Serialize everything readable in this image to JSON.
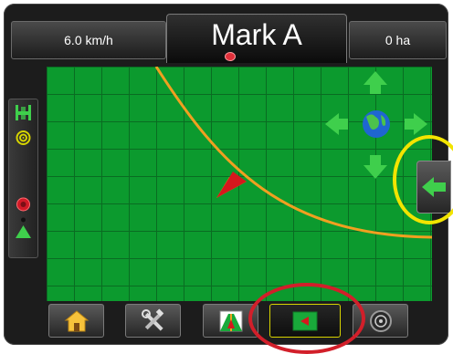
{
  "header": {
    "speed": "6.0 km/h",
    "title": "Mark A",
    "area": "0 ha"
  },
  "left_panel": {
    "icons": [
      "implement-bar-icon",
      "target-rings-icon",
      "steering-wheel-icon",
      "vehicle-marker-icon"
    ]
  },
  "map": {
    "pan_controls": [
      "pan-up-arrow-icon",
      "pan-left-arrow-icon",
      "globe-icon",
      "pan-right-arrow-icon",
      "pan-down-arrow-icon"
    ],
    "colors": {
      "field": "#0c9a2e",
      "grid": "#0a6c22",
      "guideline": "#f0a020"
    }
  },
  "side_tab": {
    "icon": "expand-left-arrow-icon"
  },
  "bottom_bar": {
    "tabs": [
      "home-icon",
      "tools-icon",
      "guidance-view-icon",
      "map-view-icon",
      "rtk-gauge-icon"
    ],
    "active_tab": "map-view-icon"
  },
  "annotations": {
    "highlight_side_tab_color": "#f2e400",
    "highlight_map_tab_color": "#d21f2a"
  }
}
